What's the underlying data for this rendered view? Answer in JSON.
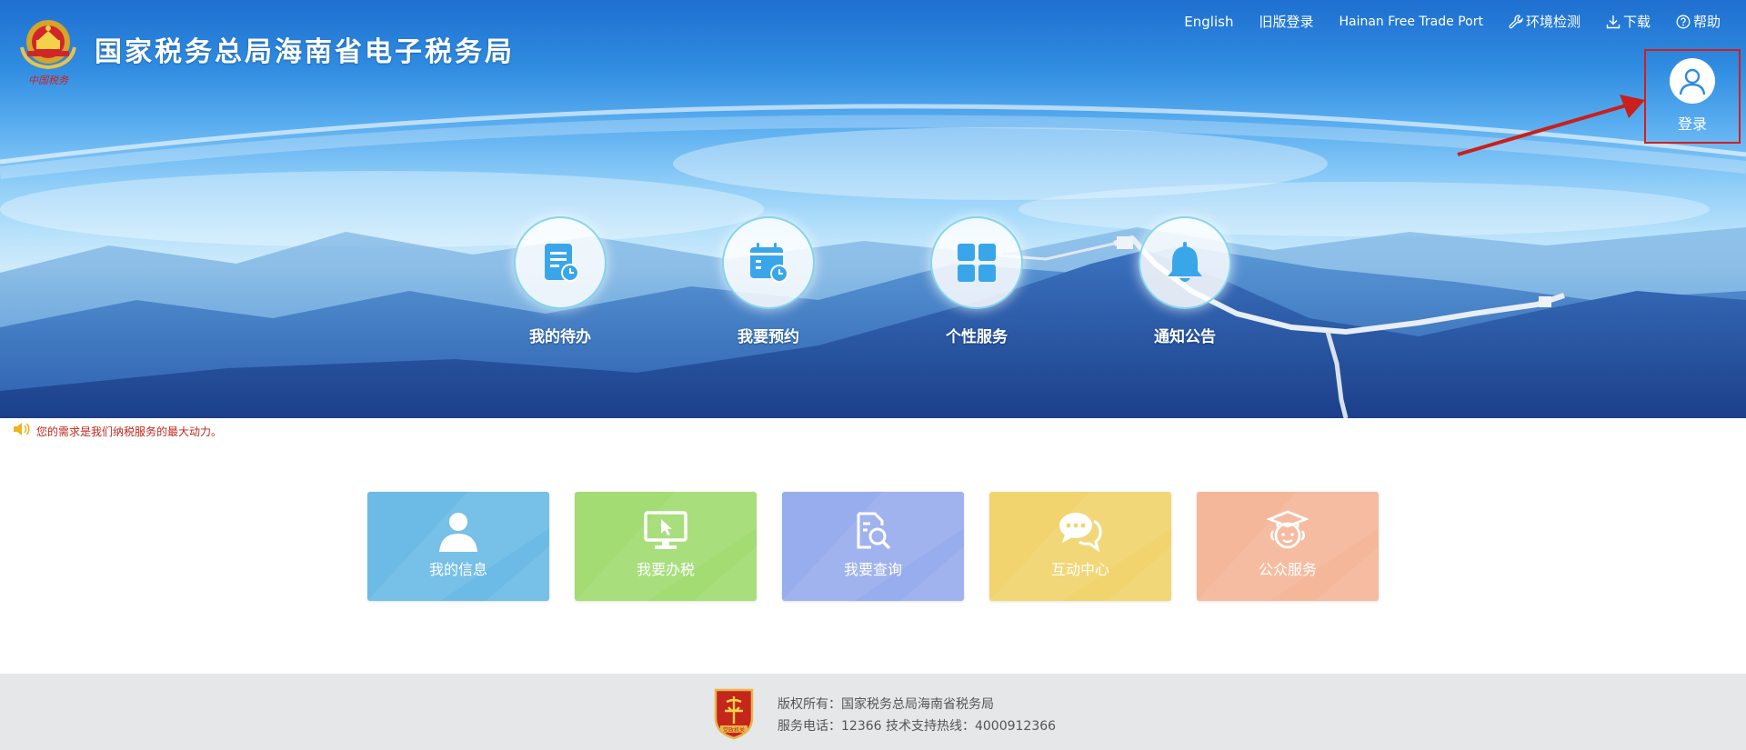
{
  "header": {
    "site_title": "国家税务总局海南省电子税务局",
    "emblem_caption": "中国税务",
    "nav": [
      {
        "label": "English",
        "icon": ""
      },
      {
        "label": "旧版登录",
        "icon": ""
      },
      {
        "label": "Hainan Free Trade Port",
        "icon": ""
      },
      {
        "label": "环境检测",
        "icon": "wrench-icon"
      },
      {
        "label": "下载",
        "icon": "download-icon"
      },
      {
        "label": "帮助",
        "icon": "help-circle-icon"
      }
    ],
    "login_label": "登录"
  },
  "quick_services": [
    {
      "label": "我的待办",
      "icon": "todo-document-clock-icon"
    },
    {
      "label": "我要预约",
      "icon": "calendar-clock-icon"
    },
    {
      "label": "个性服务",
      "icon": "grid-squares-icon"
    },
    {
      "label": "通知公告",
      "icon": "bell-icon"
    }
  ],
  "notice": {
    "text": "您的需求是我们纳税服务的最大动力。",
    "icon": "speaker-icon"
  },
  "tiles": [
    {
      "label": "我的信息",
      "icon": "user-icon",
      "color": "#6cbbe6"
    },
    {
      "label": "我要办税",
      "icon": "monitor-cursor-icon",
      "color": "#a2dc72"
    },
    {
      "label": "我要查询",
      "icon": "document-search-icon",
      "color": "#98aded"
    },
    {
      "label": "互动中心",
      "icon": "chat-bubbles-icon",
      "color": "#f1d46e"
    },
    {
      "label": "公众服务",
      "icon": "graduate-icon",
      "color": "#f5b79a"
    }
  ],
  "footer": {
    "copyright": "版权所有：国家税务总局海南省税务局",
    "contact": "服务电话：12366 技术支持热线：4000912366",
    "badge_text": "党政机关"
  },
  "colors": {
    "banner_top": "#1f6fd0",
    "annotation_red": "#d11f1f",
    "notice_red": "#c0271e",
    "footer_bg": "#e6e7e9",
    "quick_icon_blue": "#3aa6ea"
  }
}
